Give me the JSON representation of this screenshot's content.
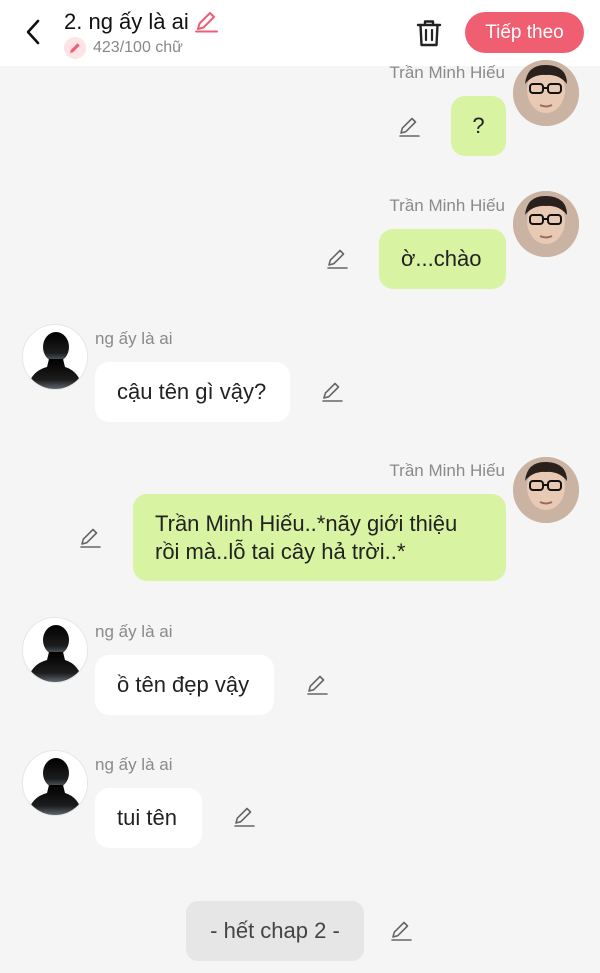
{
  "header": {
    "title": "2. ng ấy là ai",
    "word_count": "423/100 chữ",
    "next_label": "Tiếp theo"
  },
  "colors": {
    "accent": "#f05e72",
    "green_bubble": "#d8f3a1",
    "white_bubble": "#ffffff",
    "background": "#f5f5f5"
  },
  "messages": [
    {
      "side": "right",
      "sender": "Trần Minh Hiếu",
      "text": "?"
    },
    {
      "side": "right",
      "sender": "Trần Minh Hiếu",
      "text": "ờ...chào"
    },
    {
      "side": "left",
      "sender": "ng ấy là ai",
      "text": "cậu tên gì vậy?"
    },
    {
      "side": "right",
      "sender": "Trần Minh Hiếu",
      "text_line1": "Trần Minh Hiếu..*nãy giới thiệu",
      "text_line2": "rồi mà..lỗ tai cây hả trời..*"
    },
    {
      "side": "left",
      "sender": "ng ấy là ai",
      "text": "ồ tên đẹp vậy"
    },
    {
      "side": "left",
      "sender": "ng ấy là ai",
      "text": "tui tên"
    }
  ],
  "chapter_end": "- hết chap 2 -",
  "icons": {
    "back": "chevron-left-icon",
    "title_edit": "pencil-icon",
    "trash": "trash-icon",
    "message_edit": "pencil-icon"
  }
}
